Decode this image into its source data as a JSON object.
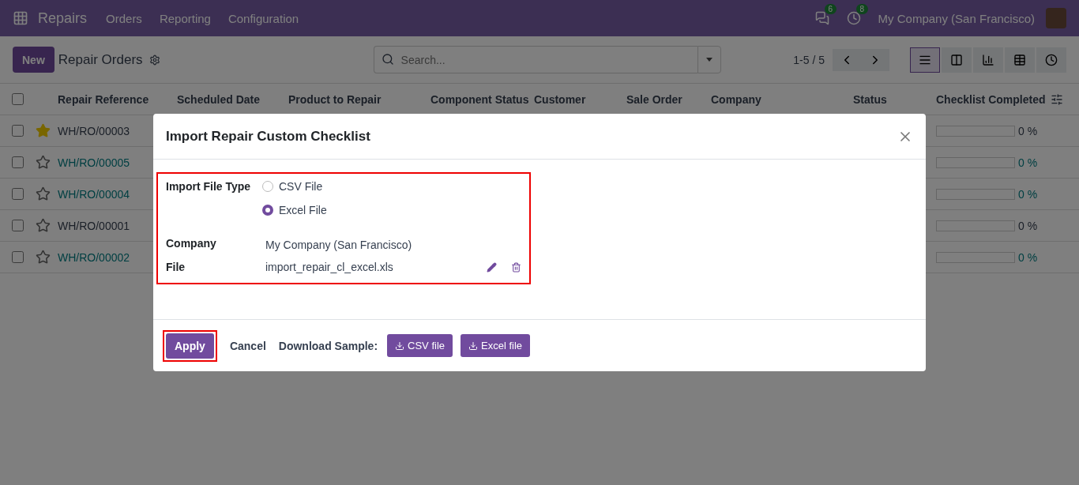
{
  "navbar": {
    "app": "Repairs",
    "menu": [
      "Orders",
      "Reporting",
      "Configuration"
    ],
    "messages_count": "6",
    "activities_count": "8",
    "company": "My Company (San Francisco)"
  },
  "control_panel": {
    "new_button": "New",
    "title": "Repair Orders",
    "search": {
      "placeholder": "Search..."
    },
    "pager": "1-5 / 5",
    "views": [
      {
        "kind": "list",
        "selected": true
      },
      {
        "kind": "kanban",
        "selected": false
      },
      {
        "kind": "graph",
        "selected": false
      },
      {
        "kind": "pivot",
        "selected": false
      },
      {
        "kind": "activity",
        "selected": false
      }
    ]
  },
  "table": {
    "all_checked": false,
    "columns": [
      "Repair Reference",
      "Scheduled Date",
      "Product to Repair",
      "Component Status",
      "Customer",
      "Sale Order",
      "Company",
      "Status",
      "Checklist Completed"
    ],
    "rows": [
      {
        "checked": false,
        "reference": "WH/RO/00003",
        "starred": true,
        "linked": false,
        "level": 0,
        "checklist": "0 %"
      },
      {
        "checked": false,
        "reference": "WH/RO/00005",
        "starred": false,
        "linked": true,
        "level": 0,
        "checklist": "0 %"
      },
      {
        "checked": false,
        "reference": "WH/RO/00004",
        "starred": false,
        "linked": true,
        "level": 0,
        "checklist": "0 %"
      },
      {
        "checked": false,
        "reference": "WH/RO/00001",
        "starred": false,
        "linked": false,
        "level": 0,
        "checklist": "0 %"
      },
      {
        "checked": false,
        "reference": "WH/RO/00002",
        "starred": false,
        "linked": true,
        "level": 0,
        "checklist": "0 %"
      }
    ]
  },
  "dialog": {
    "title": "Import Repair Custom Checklist",
    "file_type": {
      "label": "Import File Type",
      "options": [
        {
          "label": "CSV File",
          "selected": false
        },
        {
          "label": "Excel File",
          "selected": true
        }
      ]
    },
    "company": {
      "label": "Company",
      "value": "My Company (San Francisco)"
    },
    "file": {
      "label": "File",
      "value": "import_repair_cl_excel.xls"
    },
    "apply": "Apply",
    "cancel": "Cancel",
    "download_label": "Download Sample:",
    "samples": [
      "CSV file",
      "Excel file"
    ]
  }
}
